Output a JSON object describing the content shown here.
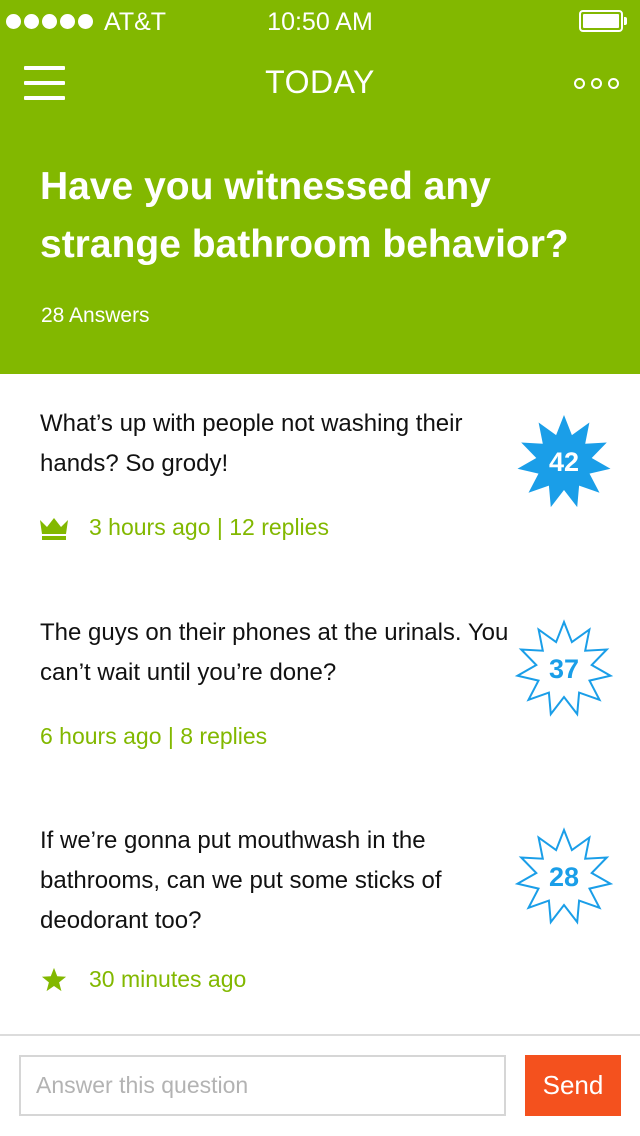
{
  "status_bar": {
    "signal_dots": 5,
    "carrier": "AT&T",
    "time": "10:50 AM",
    "battery_level": 1.0
  },
  "nav": {
    "menu_icon": "hamburger-menu-icon",
    "title": "TODAY",
    "more_icon": "more-options-icon"
  },
  "question": {
    "title": "Have you witnessed any strange bathroom behavior?",
    "answers_count": "28 Answers"
  },
  "answers": [
    {
      "text": "What’s up with people not washing their hands? So grody!",
      "meta": "3 hours ago | 12 replies",
      "badge_icon": "crown-icon",
      "votes": "42",
      "vote_style": "filled"
    },
    {
      "text": "The guys on their phones at the urinals. You can’t wait until you’re done?",
      "meta": "6 hours ago | 8 replies",
      "badge_icon": "",
      "votes": "37",
      "vote_style": "outline"
    },
    {
      "text": "If we’re gonna put mouthwash in the bathrooms, can we put some sticks of deodorant too?",
      "meta": "30 minutes ago",
      "badge_icon": "star-icon",
      "votes": "28",
      "vote_style": "outline"
    }
  ],
  "composer": {
    "placeholder": "Answer this question",
    "value": "",
    "send_label": "Send"
  },
  "colors": {
    "brand_green": "#82b800",
    "vote_blue": "#1a9ee8",
    "send_orange": "#f4511e",
    "text": "#111111"
  }
}
